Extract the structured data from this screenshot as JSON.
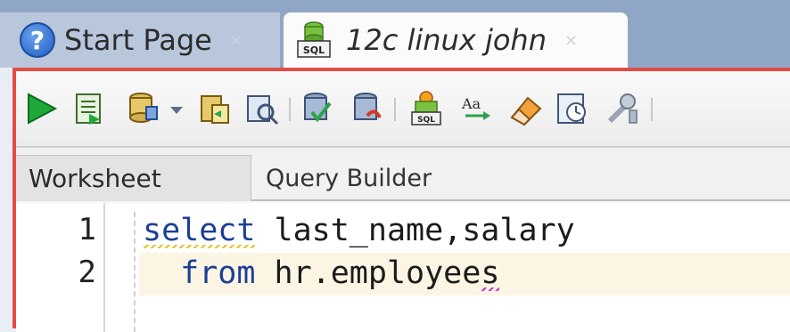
{
  "tabs": {
    "start": {
      "label": "Start Page",
      "close": "×"
    },
    "active": {
      "label": "12c linux john",
      "close": "×"
    }
  },
  "toolbar": {
    "icons": [
      "run-statement-icon",
      "run-script-icon",
      "commit-icon",
      "dropdown-arrow-icon",
      "rollback-icon",
      "explain-plan-icon",
      "autotrace-icon",
      "sql-tuning-advisor-icon",
      "sql-history-icon",
      "to-upper-lower-icon",
      "clear-icon",
      "unshared-sql-icon",
      "tools-icon"
    ]
  },
  "subtabs": {
    "worksheet": "Worksheet",
    "query_builder": "Query Builder"
  },
  "editor": {
    "line_numbers": [
      "1",
      "2"
    ],
    "line1": {
      "keyword": "select",
      "rest": " last_name,salary"
    },
    "line2": {
      "indent": "  ",
      "keyword": "from",
      "rest": " hr.employee",
      "last_char": "s"
    }
  },
  "colors": {
    "keyword": "#1c3f95",
    "panel_border": "#e54b45",
    "tab_strip": "#8fa6c6",
    "current_line": "#fcf5e3"
  }
}
